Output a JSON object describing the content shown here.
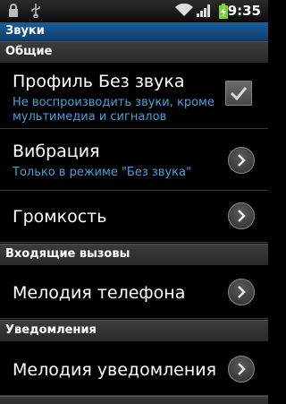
{
  "status": {
    "time": "9:35"
  },
  "title": "Звуки",
  "sections": {
    "general": "Общие",
    "incoming": "Входящие вызовы",
    "notifications": "Уведомления"
  },
  "rows": {
    "silent": {
      "title": "Профиль Без звука",
      "subtitle": "Не воспроизводить звуки, кроме мультимедиа и сигналов",
      "checked": true
    },
    "vibration": {
      "title": "Вибрация",
      "subtitle": "Только в режиме \"Без звука\""
    },
    "volume": {
      "title": "Громкость"
    },
    "ringtone": {
      "title": "Мелодия телефона"
    },
    "notification_tone": {
      "title": "Мелодия уведомления"
    }
  },
  "colors": {
    "accent": "#3ea6d9",
    "titlebar": "#1a5d99"
  }
}
